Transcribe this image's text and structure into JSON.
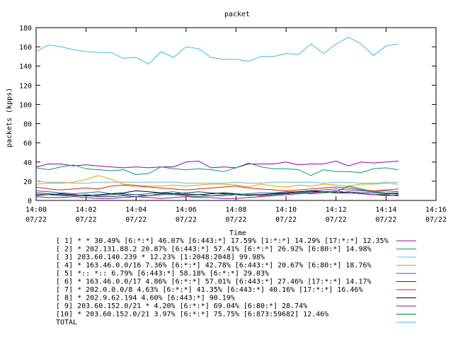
{
  "chart_data": {
    "type": "line",
    "title": "packet",
    "xlabel": "Time",
    "ylabel": "packets (kpps)",
    "ylim": [
      0,
      180
    ],
    "xlim": [
      0,
      16
    ],
    "grid": false,
    "yticks": [
      0,
      20,
      40,
      60,
      80,
      100,
      120,
      140,
      160,
      180
    ],
    "xticks": [
      {
        "at": 0,
        "time": "14:00",
        "date": "07/22"
      },
      {
        "at": 2,
        "time": "14:02",
        "date": "07/22"
      },
      {
        "at": 4,
        "time": "14:04",
        "date": "07/22"
      },
      {
        "at": 6,
        "time": "14:06",
        "date": "07/22"
      },
      {
        "at": 8,
        "time": "14:08",
        "date": "07/22"
      },
      {
        "at": 10,
        "time": "14:10",
        "date": "07/22"
      },
      {
        "at": 12,
        "time": "14:12",
        "date": "07/22"
      },
      {
        "at": 14,
        "time": "14:14",
        "date": "07/22"
      },
      {
        "at": 16,
        "time": "14:16",
        "date": "07/22"
      }
    ],
    "x": [
      0,
      0.5,
      1,
      1.5,
      2,
      2.5,
      3,
      3.5,
      4,
      4.5,
      5,
      5.5,
      6,
      6.5,
      7,
      7.5,
      8,
      8.5,
      9,
      9.5,
      10,
      10.5,
      11,
      11.5,
      12,
      12.5,
      13,
      13.5,
      14,
      14.5
    ],
    "series": [
      {
        "name": "[ 1] * * 30.49%  [6:*:*] 46.07% [6:443:*] 17.59% [1:*:*] 14.29% [17:*:*] 12.35%",
        "color": "#a000a0",
        "values": [
          35,
          38,
          38,
          36,
          37,
          36,
          35,
          34,
          35,
          34,
          35,
          35,
          40,
          41,
          34,
          35,
          34,
          38,
          38,
          38,
          40,
          37,
          38,
          38,
          41,
          36,
          40,
          39,
          40,
          41
        ]
      },
      {
        "name": "[ 2] * 202.131.88.2 20.87%  [6:443:*] 57.41% [6:*:*] 26.92% [6:80:*] 14.98%",
        "color": "#00a060",
        "values": [
          34,
          32,
          35,
          37,
          33,
          32,
          31,
          32,
          27,
          28,
          35,
          33,
          32,
          33,
          32,
          30,
          34,
          39,
          35,
          33,
          33,
          32,
          26,
          32,
          30,
          30,
          29,
          33,
          34,
          32
        ]
      },
      {
        "name": "[ 3] 203.60.140.239 * 12.23%  [1:2048:2048] 99.98%",
        "color": "#60c0e0",
        "values": [
          20,
          19,
          19,
          18,
          18,
          19,
          19,
          19,
          19,
          19,
          19,
          19,
          18,
          18,
          18,
          18,
          19,
          18,
          18,
          19,
          19,
          19,
          19,
          18,
          19,
          19,
          18,
          18,
          19,
          19
        ]
      },
      {
        "name": "[ 4] * 163.46.0.0/16 7.36%  [6:*:*] 42.78% [6:443:*] 20.67% [6:80:*] 18.76%",
        "color": "#e0a000",
        "values": [
          17,
          18,
          18,
          19,
          22,
          26,
          22,
          17,
          16,
          15,
          15,
          16,
          15,
          16,
          17,
          17,
          16,
          14,
          17,
          15,
          14,
          16,
          15,
          17,
          16,
          15,
          17,
          17,
          18,
          17
        ]
      },
      {
        "name": "[ 5] *:: *:: 6.79%  [6:443:*] 58.18% [6:*:*] 29.03%",
        "color": "#2060c0",
        "values": [
          10,
          9,
          8,
          7,
          8,
          9,
          7,
          6,
          6,
          7,
          8,
          9,
          7,
          6,
          5,
          5,
          6,
          7,
          8,
          8,
          9,
          9,
          10,
          11,
          12,
          11,
          10,
          9,
          10,
          9
        ]
      },
      {
        "name": "[ 6] * 163.46.0.0/17 4.86%  [6:*:*] 57.01% [6:443:*] 27.46% [17:*:*] 14.17%",
        "color": "#004060",
        "values": [
          8,
          7,
          6,
          5,
          5,
          4,
          4,
          5,
          4,
          5,
          6,
          7,
          8,
          9,
          8,
          7,
          6,
          5,
          6,
          7,
          7,
          8,
          9,
          9,
          8,
          9,
          8,
          8,
          7,
          7
        ]
      },
      {
        "name": "[ 7] * 202.0.0.0/8 4.63%  [6:*:*] 41.35% [6:443:*] 40.16% [17:*:*] 16.46%",
        "color": "#e02000",
        "values": [
          14,
          12,
          11,
          12,
          13,
          12,
          15,
          16,
          15,
          14,
          13,
          12,
          11,
          12,
          13,
          14,
          15,
          13,
          12,
          11,
          10,
          11,
          12,
          13,
          14,
          13,
          11,
          10,
          11,
          12
        ]
      },
      {
        "name": "[ 8] * 202.9.62.194 4.60%  [6:443:*] 90.19%",
        "color": "#000000",
        "values": [
          6,
          6,
          7,
          6,
          5,
          6,
          7,
          8,
          10,
          9,
          8,
          7,
          6,
          6,
          7,
          8,
          7,
          6,
          6,
          7,
          8,
          9,
          10,
          9,
          8,
          8,
          7,
          6,
          6,
          5
        ]
      },
      {
        "name": "[ 9] 203.60.152.0/21 * 4.20%  [6:*:*] 69.04% [6:80:*] 28.74%",
        "color": "#a000c0",
        "values": [
          4,
          3,
          3,
          4,
          3,
          2,
          2,
          3,
          4,
          3,
          2,
          3,
          4,
          3,
          3,
          2,
          2,
          3,
          4,
          5,
          6,
          7,
          8,
          9,
          10,
          8,
          7,
          6,
          5,
          6
        ]
      },
      {
        "name": "[10] * 203.60.152.0/21 3.97%  [6:*:*] 75.75% [6:873:59682] 12.46%",
        "color": "#008040",
        "values": [
          5,
          6,
          5,
          5,
          6,
          5,
          6,
          7,
          6,
          5,
          7,
          6,
          5,
          4,
          5,
          6,
          7,
          6,
          5,
          6,
          7,
          8,
          7,
          8,
          9,
          15,
          12,
          9,
          8,
          8
        ]
      },
      {
        "name": "TOTAL",
        "color": "#40b8e0",
        "values": [
          155,
          162,
          160,
          157,
          155,
          154,
          154,
          148,
          149,
          142,
          155,
          149,
          160,
          158,
          149,
          147,
          147,
          145,
          150,
          150,
          153,
          152,
          163,
          153,
          163,
          170,
          163,
          151,
          161,
          163
        ]
      }
    ]
  }
}
